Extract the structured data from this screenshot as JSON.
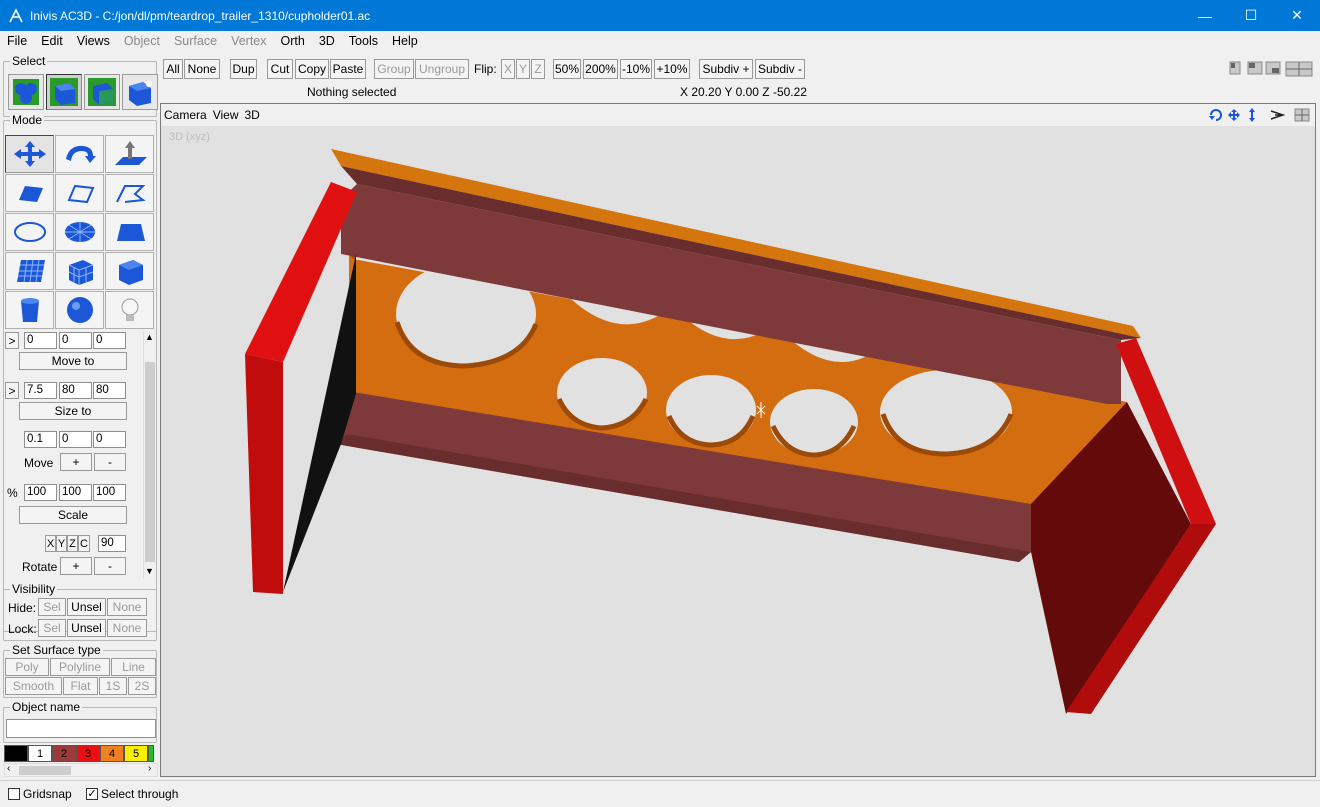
{
  "window": {
    "title": "Inivis AC3D - C:/jon/dl/pm/teardrop_trailer_1310/cupholder01.ac",
    "minimize": "—",
    "maximize": "☐",
    "close": "✕"
  },
  "menu": [
    {
      "label": "File",
      "enabled": true
    },
    {
      "label": "Edit",
      "enabled": true
    },
    {
      "label": "Views",
      "enabled": true
    },
    {
      "label": "Object",
      "enabled": false
    },
    {
      "label": "Surface",
      "enabled": false
    },
    {
      "label": "Vertex",
      "enabled": false
    },
    {
      "label": "Orth",
      "enabled": true
    },
    {
      "label": "3D",
      "enabled": true
    },
    {
      "label": "Tools",
      "enabled": true
    },
    {
      "label": "Help",
      "enabled": true
    }
  ],
  "left_panel": {
    "select_label": "Select",
    "mode_label": "Mode",
    "position": {
      "toggle": ">",
      "x": "0",
      "y": "0",
      "z": "0",
      "button": "Move to"
    },
    "size": {
      "toggle": ">",
      "x": "7.5",
      "y": "80",
      "z": "80",
      "button": "Size to"
    },
    "move": {
      "x": "0.1",
      "y": "0",
      "z": "0",
      "label": "Move",
      "plus": "+",
      "minus": "-"
    },
    "scale": {
      "percent": "%",
      "x": "100",
      "y": "100",
      "z": "100",
      "button": "Scale"
    },
    "rotate": {
      "x": "X",
      "y": "Y",
      "z": "Z",
      "c": "C",
      "angle": "90",
      "label": "Rotate",
      "plus": "+",
      "minus": "-"
    },
    "visibility": {
      "label": "Visibility",
      "hide_label": "Hide:",
      "lock_label": "Lock:",
      "sel": "Sel",
      "unsel": "Unsel",
      "none": "None"
    },
    "surface": {
      "label": "Set Surface type",
      "poly": "Poly",
      "polyline": "Polyline",
      "line": "Line",
      "smooth": "Smooth",
      "flat": "Flat",
      "one_s": "1S",
      "two_s": "2S"
    },
    "object_name": {
      "label": "Object name",
      "value": ""
    },
    "palette": [
      {
        "label": "",
        "color": "#000000",
        "text_color": "#ffffff"
      },
      {
        "label": "1",
        "color": "#ffffff",
        "text_color": "#000000"
      },
      {
        "label": "2",
        "color": "#9a3a3a",
        "text_color": "#000000"
      },
      {
        "label": "3",
        "color": "#e81010",
        "text_color": "#000000"
      },
      {
        "label": "4",
        "color": "#f08020",
        "text_color": "#000000"
      },
      {
        "label": "5",
        "color": "#f8f000",
        "text_color": "#000000"
      },
      {
        "label": "",
        "color": "#20c020",
        "text_color": "#000000"
      }
    ]
  },
  "toolbar": {
    "all": "All",
    "none": "None",
    "dup": "Dup",
    "cut": "Cut",
    "copy": "Copy",
    "paste": "Paste",
    "group": "Group",
    "ungroup": "Ungroup",
    "flip_label": "Flip:",
    "flip_x": "X",
    "flip_y": "Y",
    "flip_z": "Z",
    "p50": "50%",
    "p200": "200%",
    "m10": "-10%",
    "p10": "+10%",
    "subdiv_plus": "Subdiv +",
    "subdiv_minus": "Subdiv -"
  },
  "status": {
    "selection": "Nothing selected",
    "coords": "X 20.20 Y 0.00 Z -50.22"
  },
  "viewport": {
    "menu": [
      "Camera",
      "View",
      "3D"
    ],
    "tag": "3D (xyz)"
  },
  "bottom": {
    "gridsnap_label": "Gridsnap",
    "gridsnap_checked": false,
    "select_through_label": "Select through",
    "select_through_checked": true
  },
  "colors": {
    "orange_panel": "#d46d10",
    "brown_rail": "#7e3a3a",
    "red_end": "#d01010"
  }
}
